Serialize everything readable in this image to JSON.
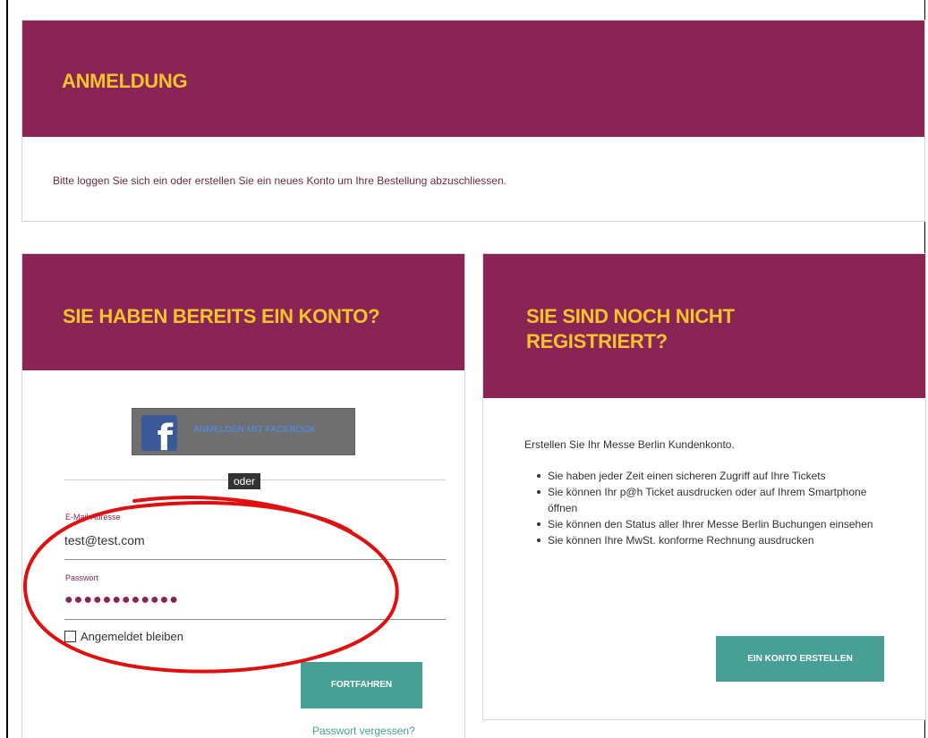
{
  "top": {
    "title": "ANMELDUNG",
    "intro": "Bitte loggen Sie sich ein oder erstellen Sie ein neues Konto um Ihre Bestellung abzuschliessen."
  },
  "login": {
    "title": "SIE HABEN BEREITS EIN KONTO?",
    "facebook_label": "ANMELDEN MIT FACEBOOK",
    "facebook_icon": "facebook-icon",
    "divider_label": "oder",
    "email_label": "E-Mail-Adresse",
    "email_value": "test@test.com",
    "password_label": "Passwort",
    "password_mask": "●●●●●●●●●●●●",
    "remember_label": "Angemeldet bleiben",
    "remember_checked": false,
    "continue_label": "FORTFAHREN",
    "forgot_label": "Passwort vergessen?"
  },
  "register": {
    "title": "SIE SIND NOCH NICHT REGISTRIERT?",
    "intro": "Erstellen Sie Ihr Messe Berlin Kundenkonto.",
    "benefits": [
      "Sie haben jeder Zeit einen sicheren Zugriff auf Ihre Tickets",
      "Sie können Ihr p@h Ticket ausdrucken oder auf Ihrem Smartphone öffnen",
      "Sie können den Status aller Ihrer Messe Berlin Buchungen einsehen",
      "Sie können Ihre MwSt. konforme Rechnung ausdrucken"
    ],
    "create_label": "EIN KONTO ERSTELLEN"
  },
  "colors": {
    "header_bg": "#8a2455",
    "title": "#f5c42c",
    "accent": "#48a095",
    "annotation": "#e01010"
  }
}
